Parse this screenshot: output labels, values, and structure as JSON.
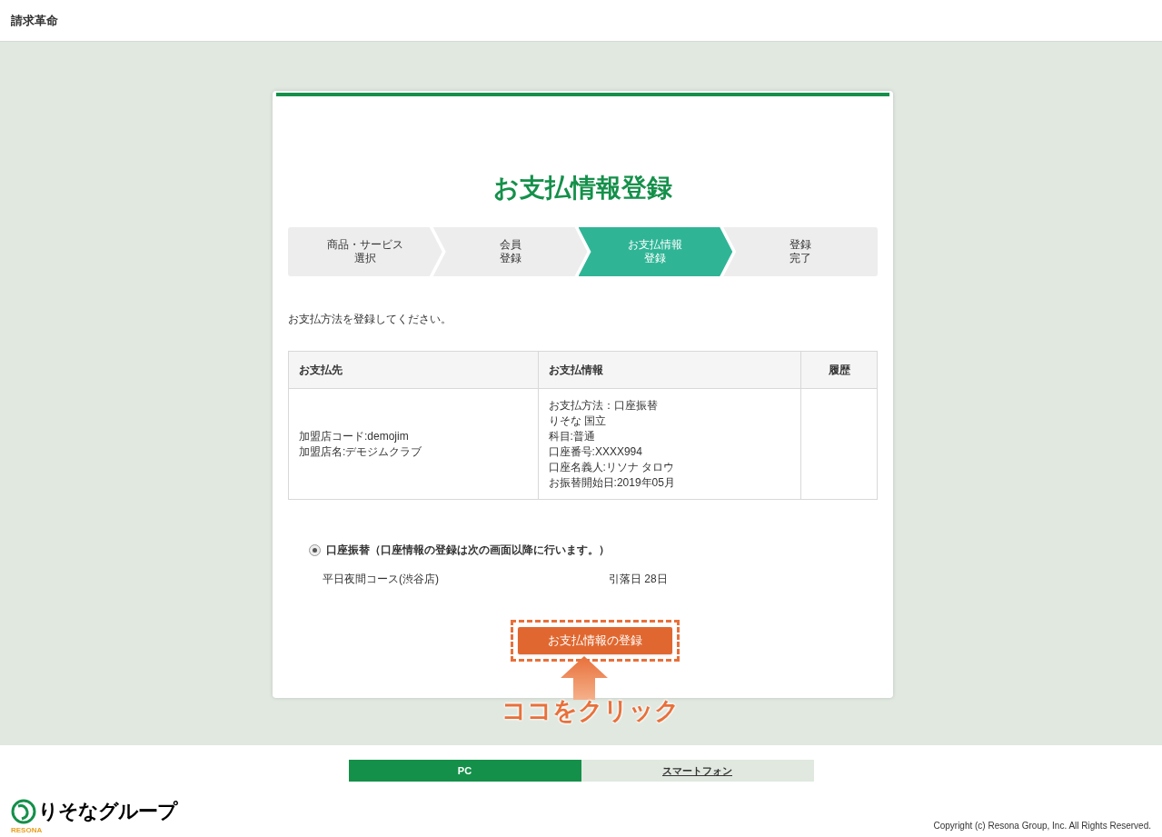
{
  "header": {
    "title": "請求革命"
  },
  "page": {
    "title": "お支払情報登録"
  },
  "steps": [
    {
      "lines": [
        "商品・サービス",
        "選択"
      ],
      "selected": false
    },
    {
      "lines": [
        "会員",
        "登録"
      ],
      "selected": false
    },
    {
      "lines": [
        "お支払情報",
        "登録"
      ],
      "selected": true
    },
    {
      "lines": [
        "登録",
        "完了"
      ],
      "selected": false
    }
  ],
  "instruction": "お支払方法を登録してください。",
  "table": {
    "columns": [
      "お支払先",
      "お支払情報",
      "履歴"
    ],
    "rows": [
      {
        "cells": [
          [
            "加盟店コード:demojim",
            "加盟店名:デモジムクラブ"
          ],
          [
            "お支払方法：口座振替",
            "りそな 国立",
            "科目:普通",
            "口座番号:XXXX994",
            "口座名義人:リソナ タロウ",
            "お振替開始日:2019年05月"
          ],
          []
        ]
      }
    ]
  },
  "payment_option": {
    "label": "口座振替（口座情報の登録は次の画面以降に行います。）",
    "selected": true,
    "course": "平日夜間コース(渋谷店)",
    "withdrawal": "引落日 28日"
  },
  "submit_button": "お支払情報の登録",
  "annotation": "ココをクリック",
  "footer": {
    "tabs": [
      {
        "label": "PC",
        "selected": true
      },
      {
        "label": "スマートフォン",
        "selected": false
      }
    ],
    "logo_text": "りそなグループ",
    "logo_sub": "RESONA",
    "copyright": "Copyright (c) Resona Group, Inc. All Rights Reserved."
  }
}
